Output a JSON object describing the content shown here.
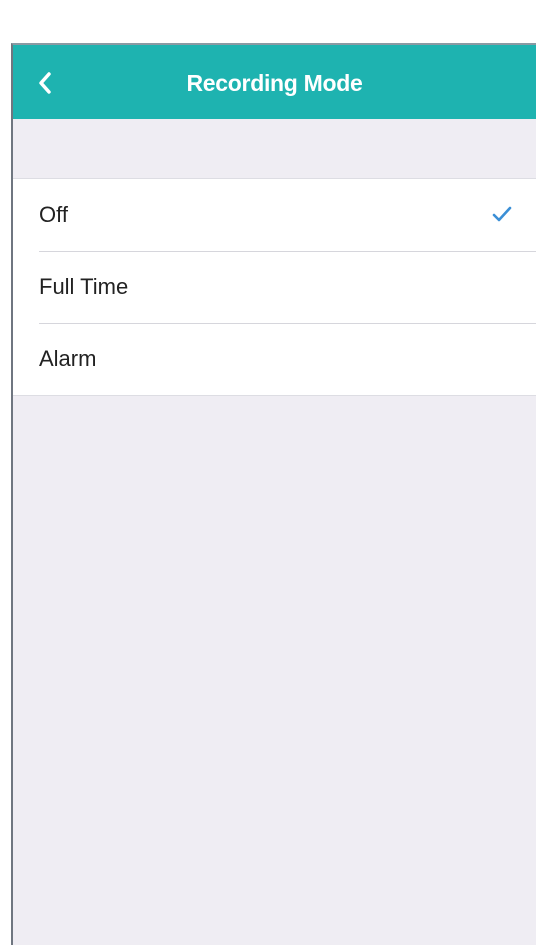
{
  "navbar": {
    "title": "Recording Mode",
    "back_icon": "chevron-left-icon",
    "background_color": "#1eb3b0"
  },
  "options": [
    {
      "label": "Off",
      "selected": true
    },
    {
      "label": "Full Time",
      "selected": false
    },
    {
      "label": "Alarm",
      "selected": false
    }
  ],
  "check_icon": "checkmark-icon",
  "check_color": "#3b8fd6"
}
